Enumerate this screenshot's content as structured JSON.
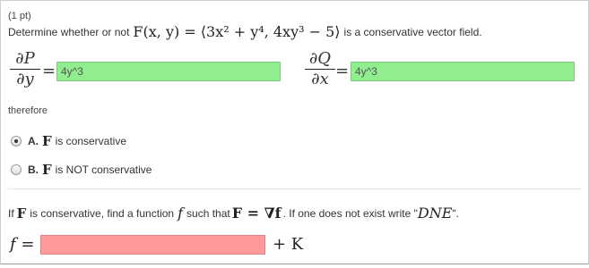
{
  "question": {
    "points": "(1 pt)",
    "prompt_prefix": "Determine whether or not",
    "field_expr": "F(x, y) = ⟨3x² + y⁴, 4xy³ − 5⟩",
    "prompt_suffix": "is a conservative vector field."
  },
  "partials": {
    "dP_num": "∂P",
    "dP_den": "∂y",
    "dQ_num": "∂Q",
    "dQ_den": "∂x",
    "equals": "=",
    "dP_value": "4y^3",
    "dQ_value": "4y^3",
    "status_color": "#90ee90"
  },
  "therefore_label": "therefore",
  "options": [
    {
      "letter": "A.",
      "symbol": "F",
      "text": "is conservative",
      "selected": true
    },
    {
      "letter": "B.",
      "symbol": "F",
      "text": "is NOT conservative",
      "selected": false
    }
  ],
  "potential": {
    "instr_if": "If",
    "instr_symbol": "F",
    "instr_mid": "is conservative, find a function",
    "instr_f": "f",
    "instr_such": "such that",
    "instr_eq": "F = ∇f",
    "instr_tail": ". If one does not exist write \"",
    "instr_dne": "DNE",
    "instr_end": "\".",
    "f_label": "f =",
    "f_value": "",
    "plus_k": "+ K",
    "status_color": "#ff9a9a"
  }
}
